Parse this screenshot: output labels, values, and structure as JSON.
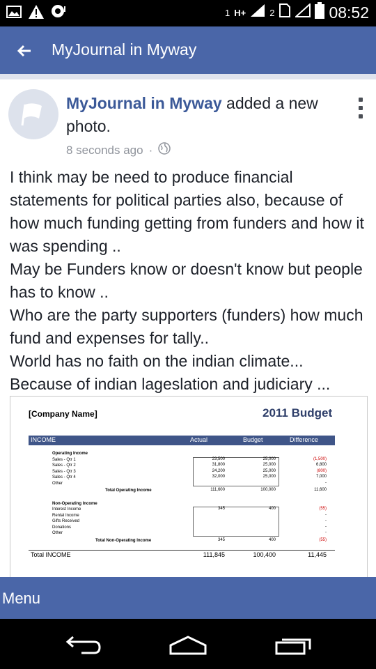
{
  "status_bar": {
    "sim_1": "1",
    "network": "H+",
    "sim_2": "2",
    "time": "08:52",
    "icons": [
      "gallery-icon",
      "warning-icon",
      "chat-icon",
      "signal-icon",
      "signal-icon",
      "no-sim-icon",
      "battery-icon"
    ]
  },
  "app_bar": {
    "title": "MyJournal in Myway",
    "back_icon": "arrow-left-icon"
  },
  "post": {
    "author": "MyJournal in Myway",
    "action": " added a new photo.",
    "timestamp": "8 seconds ago",
    "separator": "·",
    "privacy_icon": "globe-icon",
    "body_lines": [
      "I think may be need to produce financial statements for political parties also, because of how much funding getting from funders and how it was spending ..",
      "May be Funders know or doesn't know but people has to know ..",
      "Who are the party supporters (funders) how much fund and expenses for tally..",
      "World has no faith on the indian climate...",
      "Because of indian lageslation and judiciary ..."
    ]
  },
  "photo": {
    "company": "[Company Name]",
    "title": "2011 Budget",
    "headers": [
      "INCOME",
      "Actual",
      "Budget",
      "Difference"
    ],
    "operating_label": "Operating Income",
    "operating_rows": [
      {
        "label": "Sales - Qtr 1",
        "actual": "23,500",
        "budget": "25,000",
        "diff": "(1,500)",
        "neg": true
      },
      {
        "label": "Sales - Qtr 2",
        "actual": "31,800",
        "budget": "25,000",
        "diff": "6,800",
        "neg": false
      },
      {
        "label": "Sales - Qtr 3",
        "actual": "24,200",
        "budget": "25,000",
        "diff": "(800)",
        "neg": true
      },
      {
        "label": "Sales - Qtr 4",
        "actual": "32,000",
        "budget": "25,000",
        "diff": "7,000",
        "neg": false
      },
      {
        "label": "Other",
        "actual": "",
        "budget": "",
        "diff": "-",
        "neg": false
      }
    ],
    "total_operating": {
      "label": "Total Operating Income",
      "actual": "111,600",
      "budget": "100,000",
      "diff": "11,600"
    },
    "non_operating_label": "Non-Operating Income",
    "non_operating_rows": [
      {
        "label": "Interest Income",
        "actual": "345",
        "budget": "400",
        "diff": "(55)",
        "neg": true
      },
      {
        "label": "Rental Income",
        "actual": "",
        "budget": "",
        "diff": "-",
        "neg": false
      },
      {
        "label": "Gifts Received",
        "actual": "",
        "budget": "",
        "diff": "-",
        "neg": false
      },
      {
        "label": "Donations",
        "actual": "",
        "budget": "",
        "diff": "-",
        "neg": false
      },
      {
        "label": "Other",
        "actual": "",
        "budget": "",
        "diff": "-",
        "neg": false
      }
    ],
    "total_non_operating": {
      "label": "Total Non-Operating Income",
      "actual": "345",
      "budget": "400",
      "diff": "(55)"
    },
    "total_income": {
      "label": "Total INCOME",
      "actual": "111,845",
      "budget": "100,400",
      "diff": "11,445"
    }
  },
  "menu_bar": {
    "label": "Menu"
  },
  "nav_bar": {
    "icons": [
      "back-nav-icon",
      "home-nav-icon",
      "recents-nav-icon"
    ]
  },
  "colors": {
    "brand": "#4a66a8",
    "link": "#3b5998",
    "meta": "#90949c",
    "negative": "#cc0000"
  }
}
